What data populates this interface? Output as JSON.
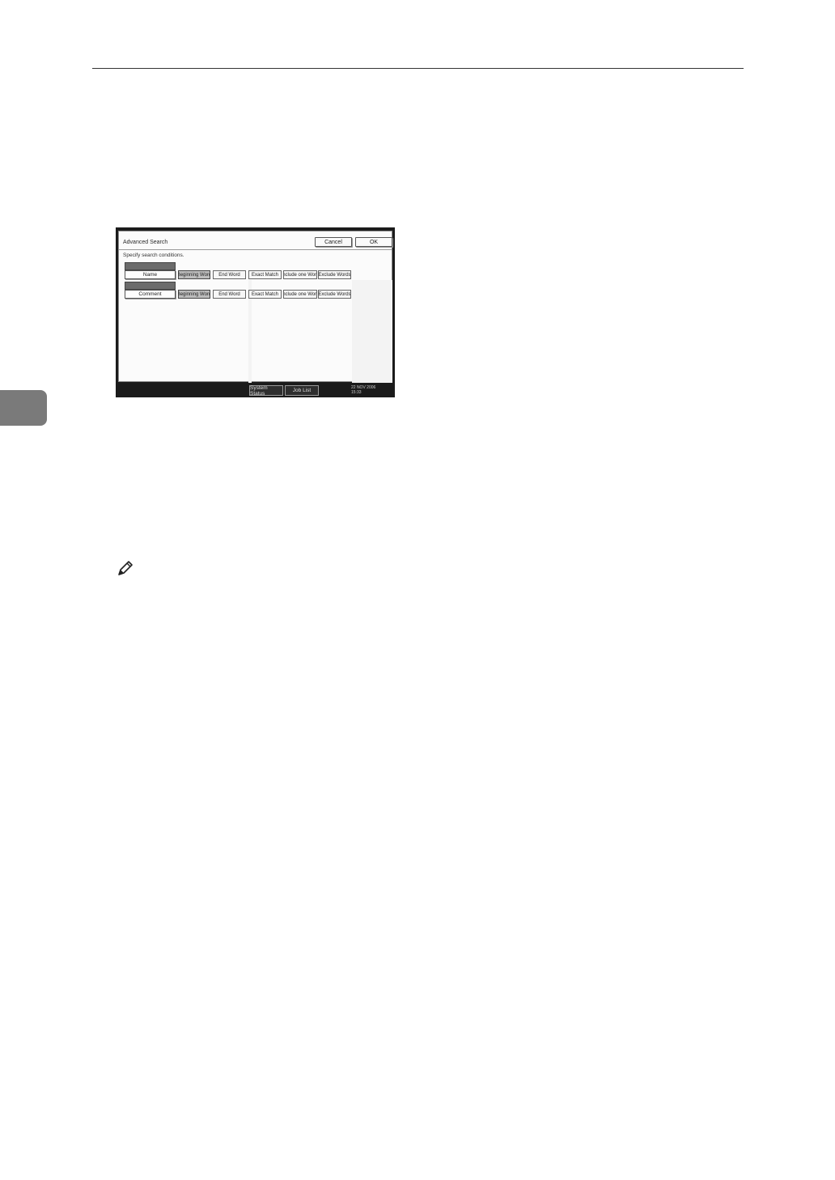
{
  "dialog": {
    "title": "Advanced Search",
    "cancel_label": "Cancel",
    "ok_label": "OK",
    "instruction": "Specify search conditions."
  },
  "fields": [
    {
      "label": "Name",
      "options": [
        "Beginning Word",
        "End Word",
        "Exact Match",
        "Include one Word",
        "Exclude Words"
      ],
      "selected": "Beginning Word"
    },
    {
      "label": "Comment",
      "options": [
        "Beginning Word",
        "End Word",
        "Exact Match",
        "Include one Word",
        "Exclude Words"
      ],
      "selected": "Beginning Word"
    }
  ],
  "status_bar": {
    "system_status_label": "System Status",
    "job_list_label": "Job List",
    "date": "22 NOV  2006",
    "time": "15:33"
  },
  "icons": {
    "note": "pencil-note-icon"
  }
}
